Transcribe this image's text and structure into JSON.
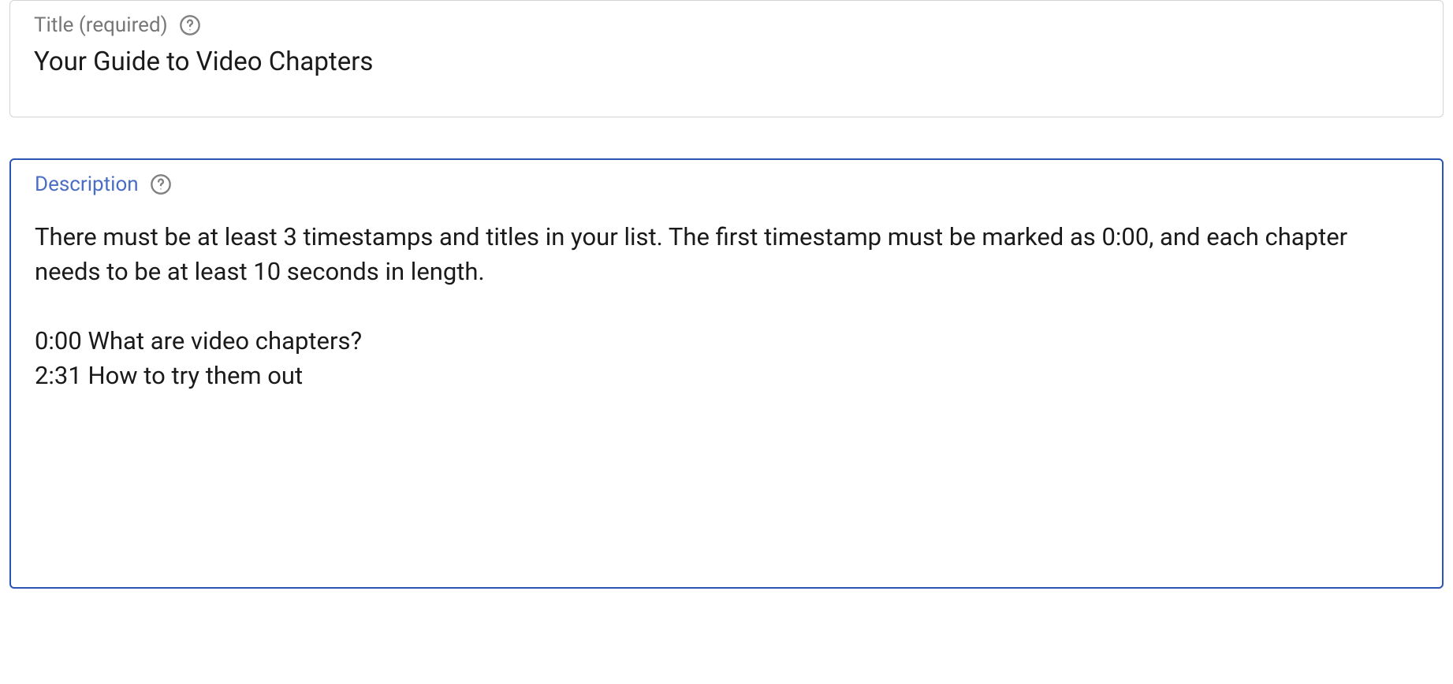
{
  "title_field": {
    "label": "Title (required)",
    "value": "Your Guide to Video Chapters"
  },
  "description_field": {
    "label": "Description",
    "value": "There must be at least 3 timestamps and titles in your list. The first timestamp must be marked as 0:00, and each chapter needs to be at least 10 seconds in length.\n\n0:00 What are video chapters?\n2:31 How to try them out"
  },
  "icons": {
    "help": "help-circle-icon"
  },
  "colors": {
    "border_default": "#d3d3d3",
    "border_active": "#2a55b3",
    "label_default": "#777777",
    "label_active": "#4a6ec2",
    "text": "#1a1a1a"
  }
}
